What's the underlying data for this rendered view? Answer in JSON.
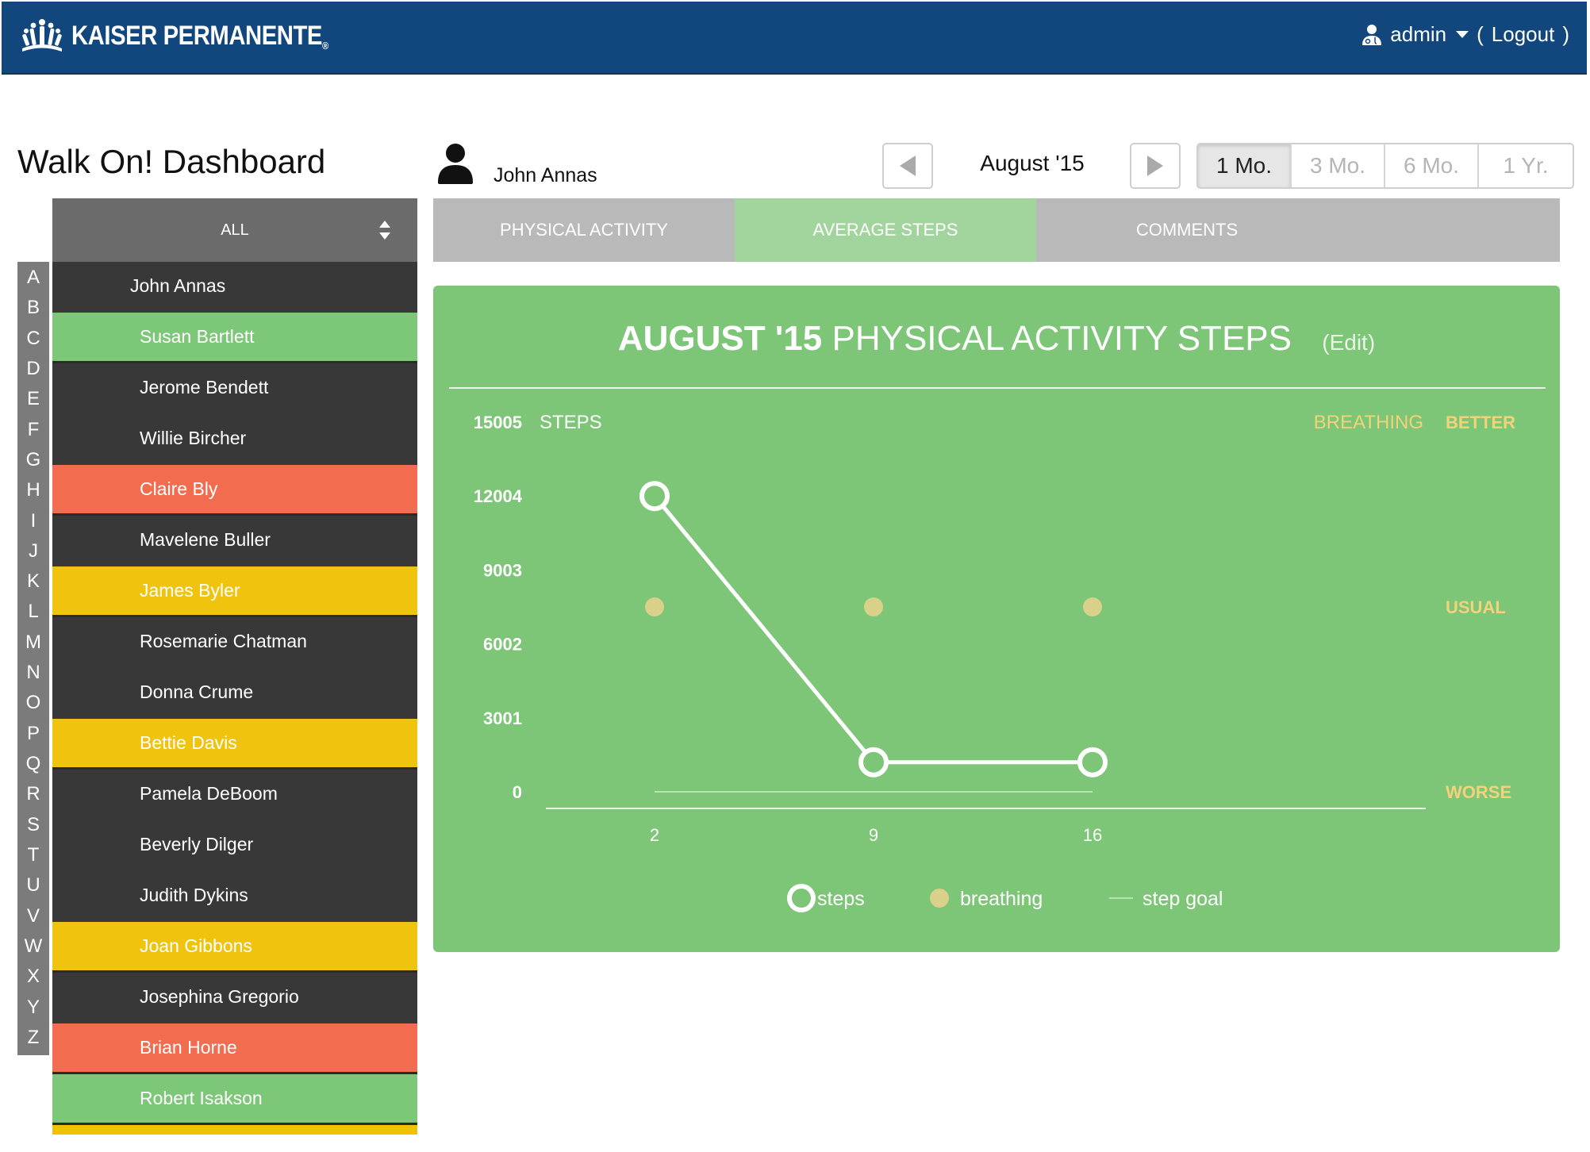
{
  "header": {
    "brand": "KAISER PERMANENTE",
    "brand_mark": "®",
    "user": "admin",
    "logout_open": "(",
    "logout": "Logout",
    "logout_close": ")"
  },
  "page_title": "Walk On! Dashboard",
  "patient_name": "John Annas",
  "period": {
    "label": "August '15",
    "ranges": [
      "1 Mo.",
      "3 Mo.",
      "6 Mo.",
      "1 Yr."
    ],
    "active_range": "1 Mo."
  },
  "sidebar": {
    "filter": "ALL",
    "letters": [
      "A",
      "B",
      "C",
      "D",
      "E",
      "F",
      "G",
      "H",
      "I",
      "J",
      "K",
      "L",
      "M",
      "N",
      "O",
      "P",
      "Q",
      "R",
      "S",
      "T",
      "U",
      "V",
      "W",
      "X",
      "Y",
      "Z"
    ],
    "patients": [
      {
        "name": "John Annas",
        "status": "selected"
      },
      {
        "name": "Susan Bartlett",
        "status": "green"
      },
      {
        "name": "Jerome Bendett",
        "status": "dark"
      },
      {
        "name": "Willie Bircher",
        "status": "dark"
      },
      {
        "name": "Claire Bly",
        "status": "red"
      },
      {
        "name": "Mavelene Buller",
        "status": "dark"
      },
      {
        "name": "James Byler",
        "status": "yellow"
      },
      {
        "name": "Rosemarie Chatman",
        "status": "dark"
      },
      {
        "name": "Donna Crume",
        "status": "dark"
      },
      {
        "name": "Bettie Davis",
        "status": "yellow"
      },
      {
        "name": "Pamela DeBoom",
        "status": "dark"
      },
      {
        "name": "Beverly Dilger",
        "status": "dark"
      },
      {
        "name": "Judith Dykins",
        "status": "dark"
      },
      {
        "name": "Joan Gibbons",
        "status": "yellow"
      },
      {
        "name": "Josephina Gregorio",
        "status": "dark"
      },
      {
        "name": "Brian Horne",
        "status": "red"
      },
      {
        "name": "Robert Isakson",
        "status": "green"
      }
    ],
    "status_colors": {
      "dark": "#383838",
      "green": "#7dc778",
      "red": "#f26d50",
      "yellow": "#f0c30f",
      "selected": "#383838"
    }
  },
  "tabs": [
    {
      "label": "PHYSICAL ACTIVITY",
      "active": false
    },
    {
      "label": "AVERAGE STEPS",
      "active": true
    },
    {
      "label": "COMMENTS",
      "active": false
    }
  ],
  "chart_data": {
    "type": "line",
    "title_bold": "AUGUST '15",
    "title_rest": "PHYSICAL ACTIVITY STEPS",
    "edit_label": "(Edit)",
    "ylabel": "STEPS",
    "y_ticks": [
      0,
      3001,
      6002,
      9003,
      12004,
      15005
    ],
    "ylim": [
      0,
      15005
    ],
    "x": [
      2,
      9,
      16
    ],
    "x_tick_labels": [
      "2",
      "9",
      "16"
    ],
    "series": [
      {
        "name": "steps",
        "values": [
          12004,
          1200,
          1200
        ],
        "color": "#ffffff"
      },
      {
        "name": "breathing",
        "values": [
          "usual",
          "usual",
          "usual"
        ],
        "color": "#d9d08a"
      },
      {
        "name": "step goal",
        "values": [
          0,
          0,
          0
        ],
        "color": "#b8e3b3"
      }
    ],
    "breathing_axis": {
      "title": "BREATHING",
      "levels": [
        "BETTER",
        "USUAL",
        "WORSE"
      ]
    },
    "legend": [
      "steps",
      "breathing",
      "step goal"
    ],
    "legend_position": "bottom",
    "colors": {
      "panel": "#7dc577",
      "breathing_text": "#f3d37a",
      "axis": "#eaf6e8"
    }
  }
}
